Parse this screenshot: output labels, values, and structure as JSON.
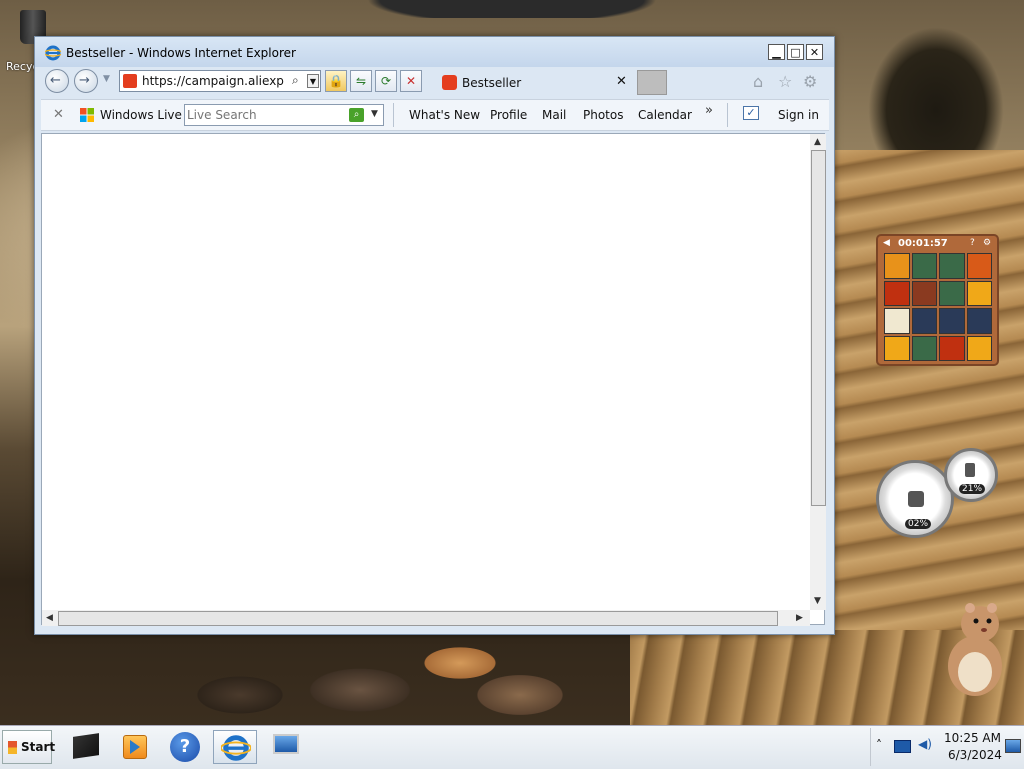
{
  "desktop": {
    "recycle_bin_label": "Recycle Bin"
  },
  "window": {
    "title": "Bestseller - Windows Internet Explorer",
    "controls": {
      "minimize": "▁",
      "maximize": "□",
      "close": "✕"
    }
  },
  "navbar": {
    "back_glyph": "←",
    "forward_glyph": "→",
    "address": "https://campaign.aliexpr...",
    "search_glyph": "⌕",
    "lock_glyph": "🔒",
    "refresh_glyph": "⟳",
    "compat_glyph": "⇋",
    "stop_glyph": "✕",
    "tab_title": "Bestseller",
    "tab_close": "✕",
    "home_glyph": "⌂",
    "favorites_glyph": "☆",
    "tools_glyph": "⚙"
  },
  "linkbar": {
    "close_glyph": "✕",
    "brand": "Windows Live",
    "search_placeholder": "Live Search",
    "search_go_glyph": "⌕",
    "links": [
      "What's New",
      "Profile",
      "Mail",
      "Photos",
      "Calendar"
    ],
    "more_glyph": "»",
    "sign_in": "Sign in"
  },
  "gadgets": {
    "puzzle_timer": "00:01:57",
    "puzzle_tiles": [
      "#e8921a",
      "#3a6a48",
      "#3a6a48",
      "#d85a18",
      "#c03010",
      "#8a3a20",
      "#3a6a48",
      "#f0a818",
      "#f0e8d0",
      "#2a3a58",
      "#2a3a58",
      "#2a3a58",
      "#f0a818",
      "#3a6a48",
      "#c03010",
      "#f0a818"
    ],
    "cpu_pct": "02%",
    "mem_pct": "21%"
  },
  "taskbar": {
    "start_label": "Start",
    "time": "10:25 AM",
    "date": "6/3/2024",
    "tray_expand": "˄"
  }
}
